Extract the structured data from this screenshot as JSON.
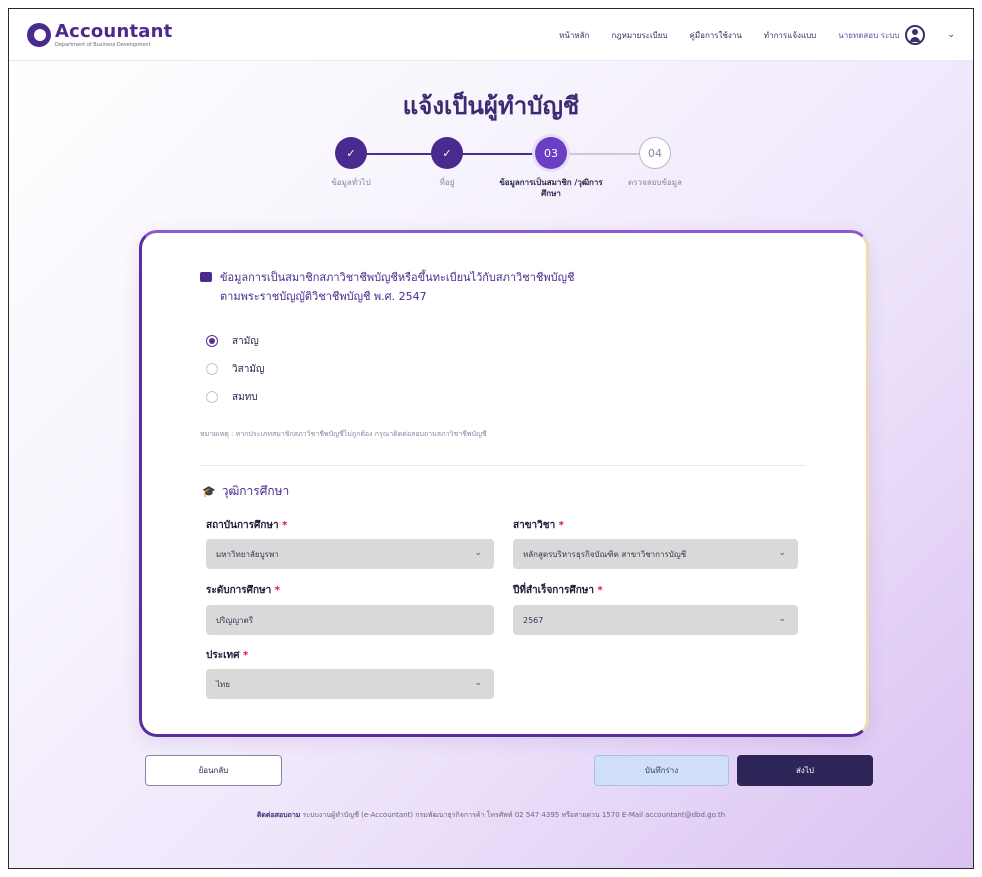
{
  "brand": {
    "name": "Accountant",
    "subtitle": "Department of Business Development"
  },
  "nav": {
    "items": [
      "หน้าหลัก",
      "กฎหมายระเบียบ",
      "คู่มือการใช้งาน",
      "ทำการแจ้งแบบ"
    ],
    "user": "นายทดสอบ ระบบ"
  },
  "page": {
    "title": "แจ้งเป็นผู้ทำบัญชี"
  },
  "stepper": {
    "steps": [
      {
        "num": "✓",
        "label": "ข้อมูลทั่วไป",
        "state": "done"
      },
      {
        "num": "✓",
        "label": "ที่อยู่",
        "state": "done"
      },
      {
        "num": "03",
        "label": "ข้อมูลการเป็นสมาชิก /วุฒิการศึกษา",
        "state": "current"
      },
      {
        "num": "04",
        "label": "ตรวจสอบข้อมูล",
        "state": "pending"
      }
    ]
  },
  "membership": {
    "heading_line1": "ข้อมูลการเป็นสมาชิกสภาวิชาชีพบัญชีหรือขึ้นทะเบียนไว้กับสภาวิชาชีพบัญชี",
    "heading_line2": "ตามพระราชบัญญัติวิชาชีพบัญชี พ.ศ. 2547",
    "options": [
      {
        "label": "สามัญ",
        "selected": true
      },
      {
        "label": "วิสามัญ",
        "selected": false
      },
      {
        "label": "สมทบ",
        "selected": false
      }
    ],
    "note": "หมายเหตุ : หากประเภทสมาชิกสภาวิชาชีพบัญชีไม่ถูกต้อง กรุณาติดต่อสอบถามสภาวิชาชีพบัญชี"
  },
  "education": {
    "heading": "วุฒิการศึกษา",
    "institution": {
      "label": "สถาบันการศึกษา",
      "value": "มหาวิทยาลัยบูรพา"
    },
    "major": {
      "label": "สาขาวิชา",
      "value": "หลักสูตรบริหารธุรกิจบัณฑิต สาขาวิชาการบัญชี"
    },
    "level": {
      "label": "ระดับการศึกษา",
      "value": "ปริญญาตรี"
    },
    "grad_year": {
      "label": "ปีที่สำเร็จการศึกษา",
      "value": "2567"
    },
    "country": {
      "label": "ประเทศ",
      "value": "ไทย"
    }
  },
  "actions": {
    "back": "ย้อนกลับ",
    "save": "บันทึกร่าง",
    "send": "ส่งไป"
  },
  "footer": {
    "prefix": "ติดต่อสอบถาม",
    "text": "ระบบงานผู้ทำบัญชี (e-Accountant) กรมพัฒนาธุรกิจการค้า โทรศัพท์ 02 547 4395 หรือสายด่วน 1570 E-Mail accountant@dbd.go.th"
  },
  "colors": {
    "primary": "#4b2a8f",
    "send_button": "#2d2458",
    "save_button": "#cfdff8"
  }
}
